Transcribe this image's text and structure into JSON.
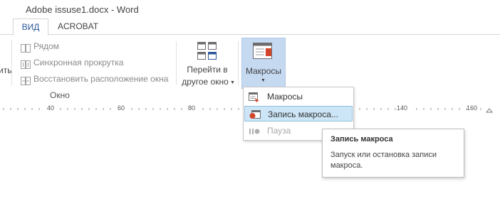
{
  "window": {
    "title": "Adobe issuse1.docx - Word"
  },
  "tabs": [
    {
      "label": "ВИД",
      "active": true
    },
    {
      "label": "ACROBAT",
      "active": false
    }
  ],
  "ribbon": {
    "left_partial_label": "ить",
    "window_group": {
      "items": [
        {
          "label": "Рядом",
          "icon": "side-by-side-icon",
          "enabled": false
        },
        {
          "label": "Синхронная прокрутка",
          "icon": "sync-scroll-icon",
          "enabled": false
        },
        {
          "label": "Восстановить расположение окна",
          "icon": "reset-window-icon",
          "enabled": false
        }
      ],
      "switch_windows": {
        "line1": "Перейти в",
        "line2": "другое окно",
        "icon": "switch-windows-icon"
      },
      "group_label": "Окно"
    },
    "macros_group": {
      "label": "Макросы",
      "icon": "macros-icon"
    }
  },
  "ruler": {
    "ticks": [
      "40",
      "60",
      "80",
      "140",
      "160"
    ]
  },
  "macros_menu": {
    "items": [
      {
        "label": "Макросы",
        "icon": "view-macros-icon",
        "state": "normal"
      },
      {
        "label": "Запись макроса...",
        "icon": "record-macro-icon",
        "state": "highlighted"
      },
      {
        "label": "Пауза",
        "icon": "pause-recording-icon",
        "state": "disabled"
      }
    ]
  },
  "tooltip": {
    "title": "Запись макроса",
    "body": "Запуск или остановка записи макроса."
  },
  "colors": {
    "accent": "#2b579a",
    "menu_highlight": "#cde6f7",
    "button_pressed": "#c5d9f1",
    "record_red": "#d2452b",
    "disabled_text": "#a8a8a8"
  }
}
